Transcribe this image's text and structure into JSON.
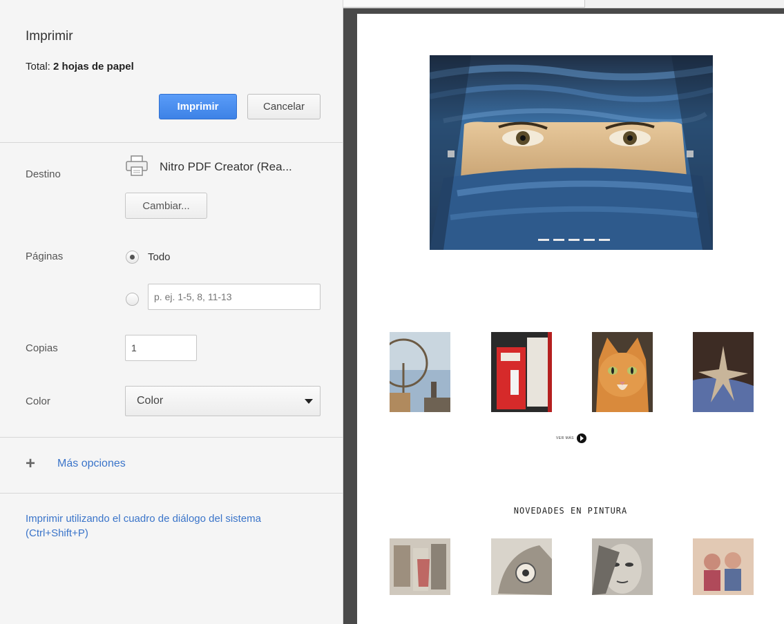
{
  "dialog": {
    "title": "Imprimir",
    "total_label": "Total:",
    "total_value": "2 hojas de papel",
    "print_button": "Imprimir",
    "cancel_button": "Cancelar"
  },
  "destination": {
    "label": "Destino",
    "printer_name": "Nitro PDF Creator (Rea...",
    "change_button": "Cambiar..."
  },
  "pages": {
    "label": "Páginas",
    "all_option": "Todo",
    "all_selected": true,
    "range_placeholder": "p. ej. 1-5, 8, 11-13"
  },
  "copies": {
    "label": "Copias",
    "value": "1"
  },
  "color": {
    "label": "Color",
    "selected": "Color",
    "options": [
      "Color"
    ]
  },
  "more_options": {
    "label": "Más opciones"
  },
  "system_dialog_link": "Imprimir utilizando el cuadro de diálogo del sistema (Ctrl+Shift+P)",
  "preview": {
    "see_more": "VER MÁS",
    "section_title": "NOVEDADES EN PINTURA"
  },
  "colors": {
    "accent": "#4a8cf0",
    "link": "#3a74c9",
    "panel_bg": "#f5f5f5",
    "preview_bg": "#4a4a4a"
  }
}
